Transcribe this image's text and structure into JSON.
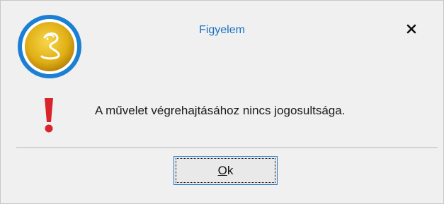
{
  "dialog": {
    "title": "Figyelem",
    "message": "A művelet végrehajtásához nincs jogosultsága.",
    "close_icon": "close-icon",
    "app_icon": "cobra-logo-icon",
    "warning_icon": "exclamation-icon",
    "ok_mnemonic": "O",
    "ok_rest": "k"
  },
  "colors": {
    "title": "#1a6fc2",
    "logo_ring": "#1b7fd4",
    "logo_gold": "#e3b318",
    "warning": "#d9242b",
    "ok_border": "#2e7ad1"
  }
}
